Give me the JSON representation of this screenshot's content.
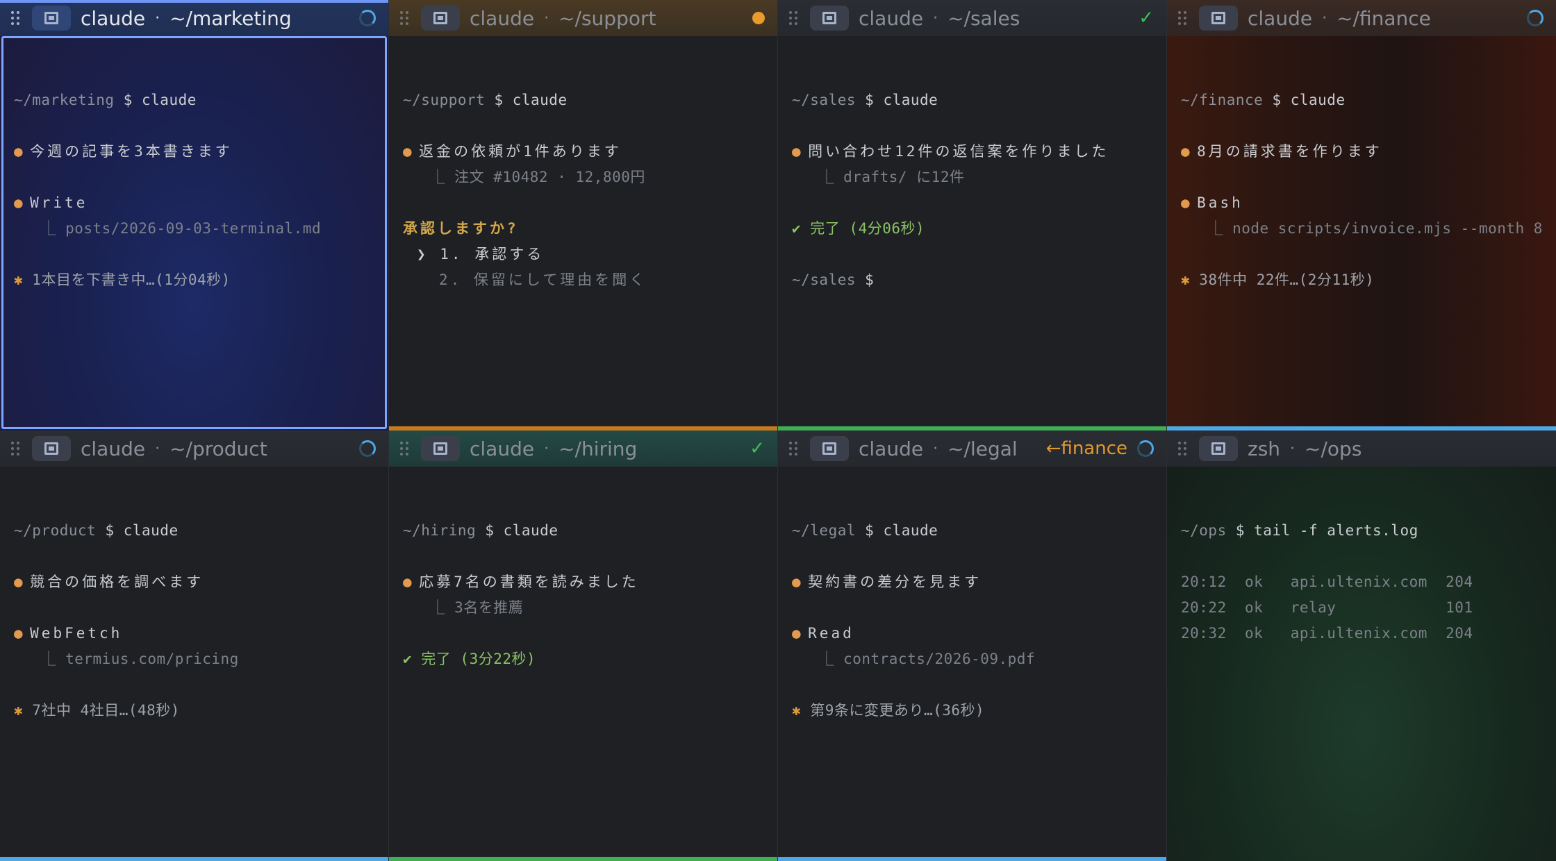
{
  "panes": [
    {
      "id": "marketing",
      "title": "claude",
      "path": "~/marketing",
      "status": "spinner",
      "active": true,
      "bottom_color": "",
      "lines": [
        {
          "t": "blank"
        },
        {
          "t": "blank"
        },
        {
          "t": "prompt",
          "path": "~/marketing",
          "cmd": "$ claude"
        },
        {
          "t": "blank"
        },
        {
          "t": "bullet",
          "text": "今週の記事を3本書きます"
        },
        {
          "t": "blank"
        },
        {
          "t": "bullet",
          "text": "Write"
        },
        {
          "t": "sub",
          "text": "posts/2026-09-03-terminal.md"
        },
        {
          "t": "blank"
        },
        {
          "t": "star",
          "text": "1本目を下書き中…(1分04秒)"
        }
      ]
    },
    {
      "id": "support",
      "title": "claude",
      "path": "~/support",
      "status": "amber",
      "active": false,
      "bottom_color": "#c77a1f",
      "lines": [
        {
          "t": "blank"
        },
        {
          "t": "blank"
        },
        {
          "t": "prompt",
          "path": "~/support",
          "cmd": "$ claude"
        },
        {
          "t": "blank"
        },
        {
          "t": "bullet",
          "text": "返金の依頼が1件あります"
        },
        {
          "t": "sub",
          "text": "注文 #10482 · 12,800円"
        },
        {
          "t": "blank"
        },
        {
          "t": "question",
          "text": "承認しますか?"
        },
        {
          "t": "choice",
          "text": "❯ 1. 承認する"
        },
        {
          "t": "choice2",
          "text": "2. 保留にして理由を聞く"
        }
      ]
    },
    {
      "id": "sales",
      "title": "claude",
      "path": "~/sales",
      "status": "check",
      "active": false,
      "bottom_color": "#3fae55",
      "lines": [
        {
          "t": "blank"
        },
        {
          "t": "blank"
        },
        {
          "t": "prompt",
          "path": "~/sales",
          "cmd": "$ claude"
        },
        {
          "t": "blank"
        },
        {
          "t": "bullet",
          "text": "問い合わせ12件の返信案を作りました"
        },
        {
          "t": "sub",
          "text": "drafts/ に12件"
        },
        {
          "t": "blank"
        },
        {
          "t": "done",
          "text": "✔ 完了 (4分06秒)"
        },
        {
          "t": "blank"
        },
        {
          "t": "prompt",
          "path": "~/sales",
          "cmd": "$"
        }
      ]
    },
    {
      "id": "finance",
      "title": "claude",
      "path": "~/finance",
      "status": "spinner",
      "active": false,
      "bottom_color": "#4ea8e6",
      "lines": [
        {
          "t": "blank"
        },
        {
          "t": "blank"
        },
        {
          "t": "prompt",
          "path": "~/finance",
          "cmd": "$ claude"
        },
        {
          "t": "blank"
        },
        {
          "t": "bullet",
          "text": "8月の請求書を作ります"
        },
        {
          "t": "blank"
        },
        {
          "t": "bullet",
          "text": "Bash"
        },
        {
          "t": "sub",
          "text": "node scripts/invoice.mjs --month 8"
        },
        {
          "t": "blank"
        },
        {
          "t": "star",
          "text": "38件中 22件…(2分11秒)"
        }
      ]
    },
    {
      "id": "product",
      "title": "claude",
      "path": "~/product",
      "status": "spinner",
      "active": false,
      "bottom_color": "#4ea8e6",
      "lines": [
        {
          "t": "blank"
        },
        {
          "t": "blank"
        },
        {
          "t": "prompt",
          "path": "~/product",
          "cmd": "$ claude"
        },
        {
          "t": "blank"
        },
        {
          "t": "bullet",
          "text": "競合の価格を調べます"
        },
        {
          "t": "blank"
        },
        {
          "t": "bullet",
          "text": "WebFetch"
        },
        {
          "t": "sub",
          "text": "termius.com/pricing"
        },
        {
          "t": "blank"
        },
        {
          "t": "star",
          "text": "7社中 4社目…(48秒)"
        }
      ]
    },
    {
      "id": "hiring",
      "title": "claude",
      "path": "~/hiring",
      "status": "check",
      "active": false,
      "bottom_color": "#3fae55",
      "lines": [
        {
          "t": "blank"
        },
        {
          "t": "blank"
        },
        {
          "t": "prompt",
          "path": "~/hiring",
          "cmd": "$ claude"
        },
        {
          "t": "blank"
        },
        {
          "t": "bullet",
          "text": "応募7名の書類を読みました"
        },
        {
          "t": "sub",
          "text": "3名を推薦"
        },
        {
          "t": "blank"
        },
        {
          "t": "done",
          "text": "✔ 完了 (3分22秒)"
        }
      ]
    },
    {
      "id": "legal",
      "title": "claude",
      "path": "~/legal",
      "status": "spinner",
      "link": "←finance",
      "active": false,
      "bottom_color": "#4ea8e6",
      "lines": [
        {
          "t": "blank"
        },
        {
          "t": "blank"
        },
        {
          "t": "prompt",
          "path": "~/legal",
          "cmd": "$ claude"
        },
        {
          "t": "blank"
        },
        {
          "t": "bullet",
          "text": "契約書の差分を見ます"
        },
        {
          "t": "blank"
        },
        {
          "t": "bullet",
          "text": "Read"
        },
        {
          "t": "sub",
          "text": "contracts/2026-09.pdf"
        },
        {
          "t": "blank"
        },
        {
          "t": "star",
          "text": "第9条に変更あり…(36秒)"
        }
      ]
    },
    {
      "id": "ops",
      "title": "zsh",
      "path": "~/ops",
      "status": "none",
      "active": false,
      "bottom_color": "",
      "lines": [
        {
          "t": "blank"
        },
        {
          "t": "blank"
        },
        {
          "t": "prompt",
          "path": "~/ops",
          "cmd": "$ tail -f alerts.log"
        },
        {
          "t": "blank"
        },
        {
          "t": "log",
          "text": "20:12  ok   api.ultenix.com  204"
        },
        {
          "t": "log",
          "text": "20:22  ok   relay            101"
        },
        {
          "t": "log",
          "text": "20:32  ok   api.ultenix.com  204"
        }
      ]
    }
  ]
}
